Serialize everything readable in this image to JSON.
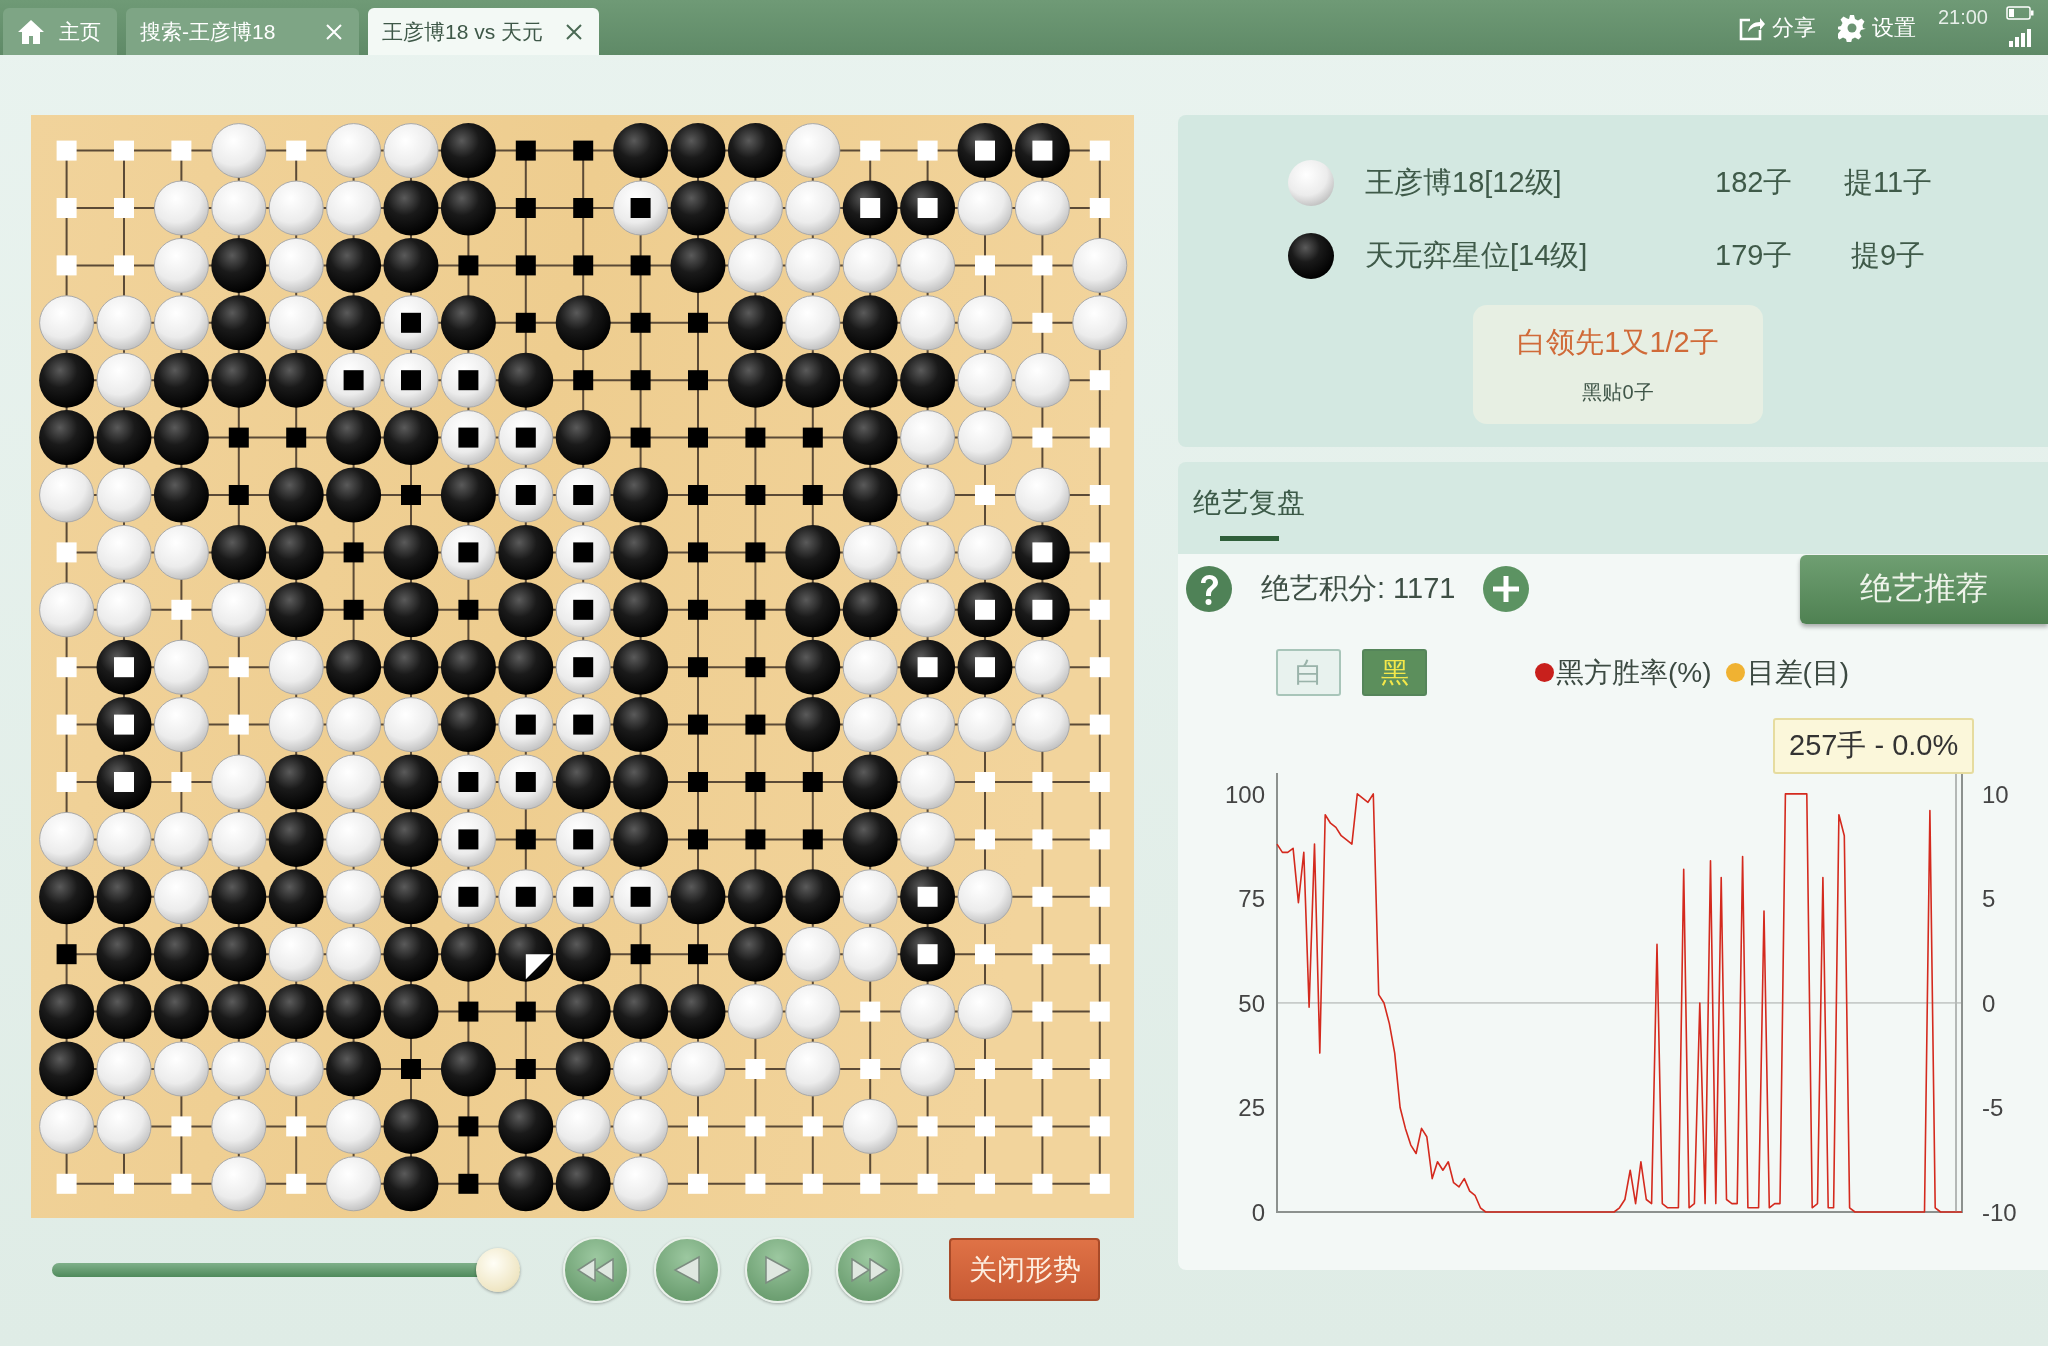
{
  "top_bar": {
    "tabs": [
      {
        "label": "主页",
        "kind": "home",
        "closable": false,
        "selected": false
      },
      {
        "label": "搜索-王彦博18",
        "kind": "page",
        "closable": true,
        "selected": false
      },
      {
        "label": "王彦博18 vs 天元",
        "kind": "page",
        "closable": true,
        "selected": true
      }
    ],
    "actions": [
      {
        "label": "分享",
        "kind": "share"
      },
      {
        "label": "设置",
        "kind": "settings"
      }
    ],
    "time": "21:00"
  },
  "board": {
    "rows": [
      [
        {
          "kind": "w"
        },
        {
          "kind": "w"
        },
        {
          "kind": "w"
        },
        {
          "kind": "W"
        },
        {
          "kind": "w"
        },
        {
          "kind": "W"
        },
        {
          "kind": "W"
        },
        {
          "kind": "B"
        },
        {
          "kind": "b"
        },
        {
          "kind": "b"
        },
        {
          "kind": "B"
        },
        {
          "kind": "B"
        },
        {
          "kind": "B"
        },
        {
          "kind": "W"
        },
        {
          "kind": "w"
        },
        {
          "kind": "w"
        },
        {
          "kind": "X"
        },
        {
          "kind": "X"
        },
        {
          "kind": "w"
        }
      ],
      [
        {
          "kind": "w"
        },
        {
          "kind": "w"
        },
        {
          "kind": "W"
        },
        {
          "kind": "W"
        },
        {
          "kind": "W"
        },
        {
          "kind": "W"
        },
        {
          "kind": "B"
        },
        {
          "kind": "B"
        },
        {
          "kind": "b"
        },
        {
          "kind": "b"
        },
        {
          "kind": "O"
        },
        {
          "kind": "B"
        },
        {
          "kind": "W"
        },
        {
          "kind": "W"
        },
        {
          "kind": "X"
        },
        {
          "kind": "X"
        },
        {
          "kind": "W"
        },
        {
          "kind": "W"
        },
        {
          "kind": "w"
        }
      ],
      [
        {
          "kind": "w"
        },
        {
          "kind": "w"
        },
        {
          "kind": "W"
        },
        {
          "kind": "B"
        },
        {
          "kind": "W"
        },
        {
          "kind": "B"
        },
        {
          "kind": "B"
        },
        {
          "kind": "b"
        },
        {
          "kind": "b"
        },
        {
          "kind": "b"
        },
        {
          "kind": "b"
        },
        {
          "kind": "B"
        },
        {
          "kind": "W"
        },
        {
          "kind": "W"
        },
        {
          "kind": "W"
        },
        {
          "kind": "W"
        },
        {
          "kind": "w"
        },
        {
          "kind": "w"
        },
        {
          "kind": "W"
        }
      ],
      [
        {
          "kind": "W"
        },
        {
          "kind": "W"
        },
        {
          "kind": "W"
        },
        {
          "kind": "B"
        },
        {
          "kind": "W"
        },
        {
          "kind": "B"
        },
        {
          "kind": "O"
        },
        {
          "kind": "B"
        },
        {
          "kind": "b"
        },
        {
          "kind": "B"
        },
        {
          "kind": "b"
        },
        {
          "kind": "b"
        },
        {
          "kind": "B"
        },
        {
          "kind": "W"
        },
        {
          "kind": "B"
        },
        {
          "kind": "W"
        },
        {
          "kind": "W"
        },
        {
          "kind": "w"
        },
        {
          "kind": "W"
        }
      ],
      [
        {
          "kind": "B"
        },
        {
          "kind": "W"
        },
        {
          "kind": "B"
        },
        {
          "kind": "B"
        },
        {
          "kind": "B"
        },
        {
          "kind": "O"
        },
        {
          "kind": "O"
        },
        {
          "kind": "O"
        },
        {
          "kind": "B"
        },
        {
          "kind": "b"
        },
        {
          "kind": "b"
        },
        {
          "kind": "b"
        },
        {
          "kind": "B"
        },
        {
          "kind": "B"
        },
        {
          "kind": "B"
        },
        {
          "kind": "B"
        },
        {
          "kind": "W"
        },
        {
          "kind": "W"
        },
        {
          "kind": "w"
        }
      ],
      [
        {
          "kind": "B"
        },
        {
          "kind": "B"
        },
        {
          "kind": "B"
        },
        {
          "kind": "b"
        },
        {
          "kind": "b"
        },
        {
          "kind": "B"
        },
        {
          "kind": "B"
        },
        {
          "kind": "O"
        },
        {
          "kind": "O"
        },
        {
          "kind": "B"
        },
        {
          "kind": "b"
        },
        {
          "kind": "b"
        },
        {
          "kind": "b"
        },
        {
          "kind": "b"
        },
        {
          "kind": "B"
        },
        {
          "kind": "W"
        },
        {
          "kind": "W"
        },
        {
          "kind": "w"
        },
        {
          "kind": "w"
        }
      ],
      [
        {
          "kind": "W"
        },
        {
          "kind": "W"
        },
        {
          "kind": "B"
        },
        {
          "kind": "b"
        },
        {
          "kind": "B"
        },
        {
          "kind": "B"
        },
        {
          "kind": "b"
        },
        {
          "kind": "B"
        },
        {
          "kind": "O"
        },
        {
          "kind": "O"
        },
        {
          "kind": "B"
        },
        {
          "kind": "b"
        },
        {
          "kind": "b"
        },
        {
          "kind": "b"
        },
        {
          "kind": "B"
        },
        {
          "kind": "W"
        },
        {
          "kind": "w"
        },
        {
          "kind": "W"
        },
        {
          "kind": "w"
        }
      ],
      [
        {
          "kind": "w"
        },
        {
          "kind": "W"
        },
        {
          "kind": "W"
        },
        {
          "kind": "B"
        },
        {
          "kind": "B"
        },
        {
          "kind": "b"
        },
        {
          "kind": "B"
        },
        {
          "kind": "O"
        },
        {
          "kind": "B"
        },
        {
          "kind": "O"
        },
        {
          "kind": "B"
        },
        {
          "kind": "b"
        },
        {
          "kind": "b"
        },
        {
          "kind": "B"
        },
        {
          "kind": "W"
        },
        {
          "kind": "W"
        },
        {
          "kind": "W"
        },
        {
          "kind": "X"
        },
        {
          "kind": "w"
        }
      ],
      [
        {
          "kind": "W"
        },
        {
          "kind": "W"
        },
        {
          "kind": "w"
        },
        {
          "kind": "W"
        },
        {
          "kind": "B"
        },
        {
          "kind": "b"
        },
        {
          "kind": "B"
        },
        {
          "kind": "b"
        },
        {
          "kind": "B"
        },
        {
          "kind": "O"
        },
        {
          "kind": "B"
        },
        {
          "kind": "b"
        },
        {
          "kind": "b"
        },
        {
          "kind": "B"
        },
        {
          "kind": "B"
        },
        {
          "kind": "W"
        },
        {
          "kind": "X"
        },
        {
          "kind": "X"
        },
        {
          "kind": "w"
        }
      ],
      [
        {
          "kind": "w"
        },
        {
          "kind": "X"
        },
        {
          "kind": "W"
        },
        {
          "kind": "w"
        },
        {
          "kind": "W"
        },
        {
          "kind": "B"
        },
        {
          "kind": "B"
        },
        {
          "kind": "B"
        },
        {
          "kind": "B"
        },
        {
          "kind": "O"
        },
        {
          "kind": "B"
        },
        {
          "kind": "b"
        },
        {
          "kind": "b"
        },
        {
          "kind": "B"
        },
        {
          "kind": "W"
        },
        {
          "kind": "X"
        },
        {
          "kind": "X"
        },
        {
          "kind": "W"
        },
        {
          "kind": "w"
        }
      ],
      [
        {
          "kind": "w"
        },
        {
          "kind": "X"
        },
        {
          "kind": "W"
        },
        {
          "kind": "w"
        },
        {
          "kind": "W"
        },
        {
          "kind": "W"
        },
        {
          "kind": "W"
        },
        {
          "kind": "B"
        },
        {
          "kind": "O"
        },
        {
          "kind": "O"
        },
        {
          "kind": "B"
        },
        {
          "kind": "b"
        },
        {
          "kind": "b"
        },
        {
          "kind": "B"
        },
        {
          "kind": "W"
        },
        {
          "kind": "W"
        },
        {
          "kind": "W"
        },
        {
          "kind": "W"
        },
        {
          "kind": "w"
        }
      ],
      [
        {
          "kind": "w"
        },
        {
          "kind": "X"
        },
        {
          "kind": "w"
        },
        {
          "kind": "W"
        },
        {
          "kind": "B"
        },
        {
          "kind": "W"
        },
        {
          "kind": "B"
        },
        {
          "kind": "O"
        },
        {
          "kind": "O"
        },
        {
          "kind": "B"
        },
        {
          "kind": "B"
        },
        {
          "kind": "b"
        },
        {
          "kind": "b"
        },
        {
          "kind": "b"
        },
        {
          "kind": "B"
        },
        {
          "kind": "W"
        },
        {
          "kind": "w"
        },
        {
          "kind": "w"
        },
        {
          "kind": "w"
        }
      ],
      [
        {
          "kind": "W"
        },
        {
          "kind": "W"
        },
        {
          "kind": "W"
        },
        {
          "kind": "W"
        },
        {
          "kind": "B"
        },
        {
          "kind": "W"
        },
        {
          "kind": "B"
        },
        {
          "kind": "O"
        },
        {
          "kind": "b"
        },
        {
          "kind": "O"
        },
        {
          "kind": "B"
        },
        {
          "kind": "b"
        },
        {
          "kind": "b"
        },
        {
          "kind": "b"
        },
        {
          "kind": "B"
        },
        {
          "kind": "W"
        },
        {
          "kind": "w"
        },
        {
          "kind": "w"
        },
        {
          "kind": "w"
        }
      ],
      [
        {
          "kind": "B"
        },
        {
          "kind": "B"
        },
        {
          "kind": "W"
        },
        {
          "kind": "B"
        },
        {
          "kind": "B"
        },
        {
          "kind": "W"
        },
        {
          "kind": "B"
        },
        {
          "kind": "O"
        },
        {
          "kind": "O"
        },
        {
          "kind": "O"
        },
        {
          "kind": "O"
        },
        {
          "kind": "B"
        },
        {
          "kind": "B"
        },
        {
          "kind": "B"
        },
        {
          "kind": "W"
        },
        {
          "kind": "X"
        },
        {
          "kind": "W"
        },
        {
          "kind": "w"
        },
        {
          "kind": "w"
        }
      ],
      [
        {
          "kind": "b"
        },
        {
          "kind": "B"
        },
        {
          "kind": "B"
        },
        {
          "kind": "B"
        },
        {
          "kind": "W"
        },
        {
          "kind": "W"
        },
        {
          "kind": "B"
        },
        {
          "kind": "B"
        },
        {
          "kind": "L"
        },
        {
          "kind": "B"
        },
        {
          "kind": "b"
        },
        {
          "kind": "b"
        },
        {
          "kind": "B"
        },
        {
          "kind": "W"
        },
        {
          "kind": "W"
        },
        {
          "kind": "X"
        },
        {
          "kind": "w"
        },
        {
          "kind": "w"
        },
        {
          "kind": "w"
        }
      ],
      [
        {
          "kind": "B"
        },
        {
          "kind": "B"
        },
        {
          "kind": "B"
        },
        {
          "kind": "B"
        },
        {
          "kind": "B"
        },
        {
          "kind": "B"
        },
        {
          "kind": "B"
        },
        {
          "kind": "b"
        },
        {
          "kind": "b"
        },
        {
          "kind": "B"
        },
        {
          "kind": "B"
        },
        {
          "kind": "B"
        },
        {
          "kind": "W"
        },
        {
          "kind": "W"
        },
        {
          "kind": "w"
        },
        {
          "kind": "W"
        },
        {
          "kind": "W"
        },
        {
          "kind": "w"
        },
        {
          "kind": "w"
        }
      ],
      [
        {
          "kind": "B"
        },
        {
          "kind": "W"
        },
        {
          "kind": "W"
        },
        {
          "kind": "W"
        },
        {
          "kind": "W"
        },
        {
          "kind": "B"
        },
        {
          "kind": "b"
        },
        {
          "kind": "B"
        },
        {
          "kind": "b"
        },
        {
          "kind": "B"
        },
        {
          "kind": "W"
        },
        {
          "kind": "W"
        },
        {
          "kind": "w"
        },
        {
          "kind": "W"
        },
        {
          "kind": "w"
        },
        {
          "kind": "W"
        },
        {
          "kind": "w"
        },
        {
          "kind": "w"
        },
        {
          "kind": "w"
        }
      ],
      [
        {
          "kind": "W"
        },
        {
          "kind": "W"
        },
        {
          "kind": "w"
        },
        {
          "kind": "W"
        },
        {
          "kind": "w"
        },
        {
          "kind": "W"
        },
        {
          "kind": "B"
        },
        {
          "kind": "b"
        },
        {
          "kind": "B"
        },
        {
          "kind": "W"
        },
        {
          "kind": "W"
        },
        {
          "kind": "w"
        },
        {
          "kind": "w"
        },
        {
          "kind": "w"
        },
        {
          "kind": "W"
        },
        {
          "kind": "w"
        },
        {
          "kind": "w"
        },
        {
          "kind": "w"
        },
        {
          "kind": "w"
        }
      ],
      [
        {
          "kind": "w"
        },
        {
          "kind": "w"
        },
        {
          "kind": "w"
        },
        {
          "kind": "W"
        },
        {
          "kind": "w"
        },
        {
          "kind": "W"
        },
        {
          "kind": "B"
        },
        {
          "kind": "b"
        },
        {
          "kind": "B"
        },
        {
          "kind": "B"
        },
        {
          "kind": "W"
        },
        {
          "kind": "w"
        },
        {
          "kind": "w"
        },
        {
          "kind": "w"
        },
        {
          "kind": "w"
        },
        {
          "kind": "w"
        },
        {
          "kind": "w"
        },
        {
          "kind": "w"
        },
        {
          "kind": "w"
        }
      ]
    ]
  },
  "playback": {
    "level": 1,
    "buttons": [
      {
        "kind": "first"
      },
      {
        "kind": "prev"
      },
      {
        "kind": "next"
      },
      {
        "kind": "last"
      }
    ],
    "toggle_button": "关闭形势"
  },
  "players": [
    {
      "kind": "white",
      "name": "王彦博18[12级]",
      "stones": "182子",
      "captures": "提11子"
    },
    {
      "kind": "black",
      "name": "天元弈星位[14级]",
      "stones": "179子",
      "captures": "提9子"
    }
  ],
  "result": {
    "lead": "白领先1又1/2子",
    "komi": "黑贴0子"
  },
  "analysis": {
    "tabs": [
      {
        "label": "绝艺复盘",
        "selected": true
      }
    ],
    "score": "绝艺积分: 1171",
    "recommend_button": "绝艺推荐",
    "side_toggle": [
      {
        "label": "白",
        "selected": false
      },
      {
        "label": "黑",
        "selected": true
      }
    ],
    "legend": [
      {
        "label": "黑方胜率(%)",
        "color": "#c8201c"
      },
      {
        "label": "目差(目)",
        "color": "#f0b232"
      }
    ],
    "tooltip": "257手 - 0.0%",
    "right_axis_ticks": [
      "10",
      "5",
      "0",
      "-5",
      "-10"
    ],
    "chart_data": {
      "type": "line",
      "ylim": [
        0,
        105
      ],
      "ref_lines": [
        {
          "axis": "y",
          "value": 50
        }
      ],
      "yticks": [
        0,
        25,
        50,
        75,
        100
      ],
      "categories": [
        null,
        null,
        null,
        null,
        null,
        null,
        null,
        null,
        null,
        null,
        null,
        null,
        null,
        null,
        null,
        null,
        null,
        null,
        null,
        null,
        null,
        null,
        null,
        null,
        null,
        null,
        null,
        null,
        null,
        null,
        null,
        null,
        null,
        null,
        null,
        null,
        null,
        null,
        null,
        null,
        null,
        null,
        null,
        null,
        null,
        null,
        null,
        null,
        null,
        null,
        null,
        null,
        null,
        null,
        null,
        null,
        null,
        null,
        null,
        null,
        null,
        null,
        null,
        null,
        null,
        null,
        null,
        null,
        null,
        null,
        null,
        null,
        null,
        null,
        null,
        null,
        null,
        null,
        null,
        null,
        null,
        null,
        null,
        null,
        null,
        null,
        null,
        null,
        null,
        null,
        null,
        null,
        null,
        null,
        null,
        null,
        null,
        null,
        null,
        null,
        null,
        null,
        null,
        null,
        null,
        null,
        null,
        null,
        null,
        null,
        null,
        null,
        null,
        null,
        null,
        null,
        null,
        null,
        null,
        null,
        null,
        null,
        null,
        null,
        null,
        null,
        null,
        null,
        null
      ],
      "series": [
        {
          "color": "#d42a1e",
          "values": [
            88,
            86,
            86,
            87,
            74,
            86,
            49,
            88,
            38,
            95,
            93,
            92,
            90,
            89,
            88,
            100,
            99,
            98,
            100,
            52,
            50,
            45,
            38,
            25,
            20,
            16,
            14,
            20,
            18,
            8,
            12,
            10,
            12,
            7,
            6,
            8,
            5,
            4,
            1,
            0,
            0,
            0,
            0,
            0,
            0,
            0,
            0,
            0,
            0,
            0,
            0,
            0,
            0,
            0,
            0,
            0,
            0,
            0,
            0,
            0,
            0,
            0,
            0,
            0,
            1,
            3,
            10,
            2,
            12,
            3,
            2,
            64,
            2,
            1,
            1,
            1,
            82,
            1,
            2,
            50,
            2,
            84,
            2,
            80,
            3,
            2,
            2,
            85,
            1,
            1,
            1,
            72,
            1,
            2,
            2,
            100,
            100,
            100,
            100,
            100,
            1,
            2,
            80,
            1,
            1,
            95,
            90,
            1,
            0,
            0,
            0,
            0,
            0,
            0,
            0,
            0,
            0,
            0,
            0,
            0,
            0,
            0,
            96,
            1,
            0,
            0,
            0,
            0,
            0
          ]
        }
      ]
    }
  }
}
